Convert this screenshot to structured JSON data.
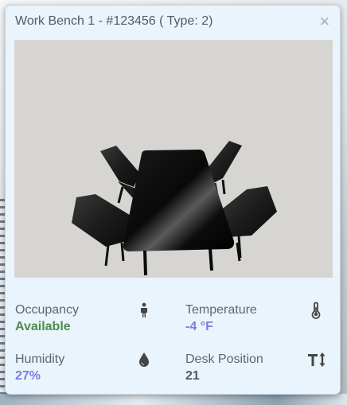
{
  "panel": {
    "title": "Work Bench 1 - #123456 ( Type: 2)",
    "close_icon": "close-icon"
  },
  "stats": [
    {
      "label": "Occupancy",
      "value": "Available",
      "icon": "person-icon",
      "value_color": "#4b8d4b"
    },
    {
      "label": "Temperature",
      "value": "-4 °F",
      "icon": "thermometer-icon",
      "value_color": "#7a7ce6"
    },
    {
      "label": "Humidity",
      "value": "27%",
      "icon": "water-drop-icon",
      "value_color": "#7a7ce6"
    },
    {
      "label": "Desk Position",
      "value": "21",
      "icon": "height-adjust-icon",
      "value_color": "#555a5f"
    }
  ],
  "colors": {
    "panel_bg": "#eaf4fc",
    "viewport_bg": "#d6d5d1"
  }
}
